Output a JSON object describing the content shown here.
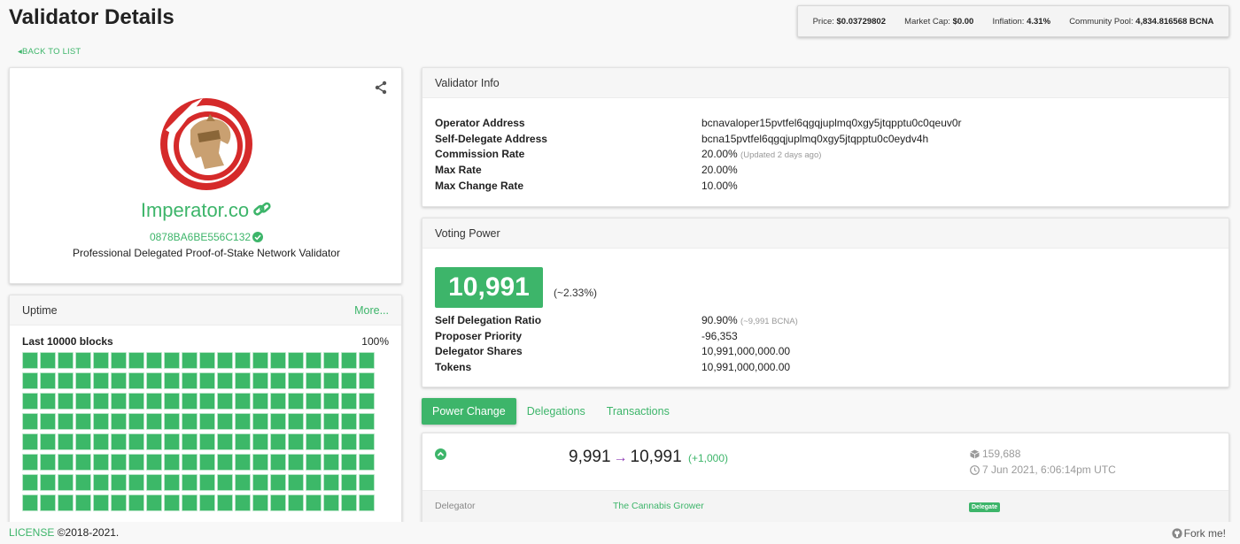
{
  "page": {
    "title": "Validator Details",
    "back_label": "BACK TO LIST"
  },
  "market": {
    "price_label": "Price:",
    "price_value": "$0.03729802",
    "cap_label": "Market Cap:",
    "cap_value": "$0.00",
    "inflation_label": "Inflation:",
    "inflation_value": "4.31%",
    "pool_label": "Community Pool:",
    "pool_value": "4,834.816568 BCNA"
  },
  "profile": {
    "moniker": "Imperator.co",
    "identity": "0878BA6BE556C132",
    "details": "Professional Delegated Proof-of-Stake Network Validator",
    "icons": [
      "share-icon",
      "link-icon",
      "verified-check-icon"
    ]
  },
  "uptime": {
    "title": "Uptime",
    "more_label": "More...",
    "blocks_label": "Last 10000 blocks",
    "percentage": "100%",
    "visible_blocks": 160,
    "blocks_per_row": 20,
    "block_color": "#3cb868"
  },
  "validator_info": {
    "title": "Validator Info",
    "operator_label": "Operator Address",
    "operator_value": "bcnavaloper15pvtfel6qgqjuplmq0xgy5jtqpptu0c0qeuv0r",
    "self_delegate_label": "Self-Delegate Address",
    "self_delegate_value": "bcna15pvtfel6qgqjuplmq0xgy5jtqpptu0c0eydv4h",
    "commission_label": "Commission Rate",
    "commission_value": "20.00%",
    "commission_note": "(Updated 2 days ago)",
    "max_rate_label": "Max Rate",
    "max_rate_value": "20.00%",
    "max_change_label": "Max Change Rate",
    "max_change_value": "10.00%"
  },
  "voting_power": {
    "title": "Voting Power",
    "power": "10,991",
    "percentage": "(~2.33%)",
    "self_ratio_label": "Self Delegation Ratio",
    "self_ratio_value": "90.90%",
    "self_ratio_note": "(~9,991 BCNA)",
    "priority_label": "Proposer Priority",
    "priority_value": "-96,353",
    "shares_label": "Delegator Shares",
    "shares_value": "10,991,000,000.00",
    "tokens_label": "Tokens",
    "tokens_value": "10,991,000,000.00"
  },
  "tabs": [
    {
      "label": "Power Change",
      "active": true
    },
    {
      "label": "Delegations",
      "active": false
    },
    {
      "label": "Transactions",
      "active": false
    }
  ],
  "power_change": {
    "from": "9,991",
    "arrow": "→",
    "to": "10,991",
    "diff": "(+1,000)",
    "height": "159,688",
    "time": "7 Jun 2021, 6:06:14pm UTC",
    "delegator_label": "Delegator",
    "delegator_value": "The Cannabis Grower",
    "badge": "Delegate"
  },
  "footer": {
    "license": "LICENSE",
    "copyright": "©2018-2021.",
    "fork": "Fork me!"
  },
  "colors": {
    "accent": "#3db56a",
    "arrow": "#8e3bb5",
    "logo_red": "#d52a2a",
    "logo_gold": "#c9a071"
  }
}
